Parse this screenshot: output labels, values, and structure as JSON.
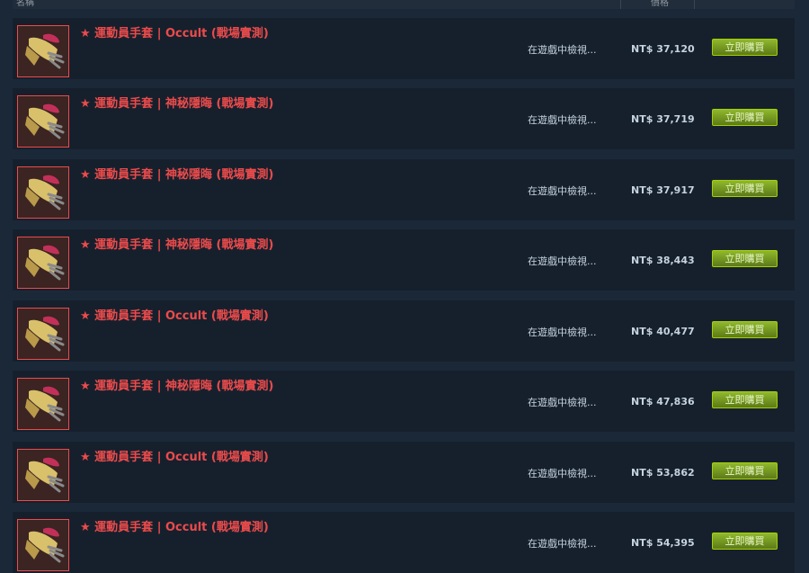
{
  "header": {
    "name_col": "名稱",
    "price_col": "價格"
  },
  "listings": [
    {
      "name": "★ 運動員手套 | Occult (戰場實測)",
      "inspect": "在遊戲中檢視...",
      "price": "NT$ 37,120",
      "buy": "立即購買"
    },
    {
      "name": "★ 運動員手套 | 神秘隱晦 (戰場實測)",
      "inspect": "在遊戲中檢視...",
      "price": "NT$ 37,719",
      "buy": "立即購買"
    },
    {
      "name": "★ 運動員手套 | 神秘隱晦 (戰場實測)",
      "inspect": "在遊戲中檢視...",
      "price": "NT$ 37,917",
      "buy": "立即購買"
    },
    {
      "name": "★ 運動員手套 | 神秘隱晦 (戰場實測)",
      "inspect": "在遊戲中檢視...",
      "price": "NT$ 38,443",
      "buy": "立即購買"
    },
    {
      "name": "★ 運動員手套 | Occult (戰場實測)",
      "inspect": "在遊戲中檢視...",
      "price": "NT$ 40,477",
      "buy": "立即購買"
    },
    {
      "name": "★ 運動員手套 | 神秘隱晦 (戰場實測)",
      "inspect": "在遊戲中檢視...",
      "price": "NT$ 47,836",
      "buy": "立即購買"
    },
    {
      "name": "★ 運動員手套 | Occult (戰場實測)",
      "inspect": "在遊戲中檢視...",
      "price": "NT$ 53,862",
      "buy": "立即購買"
    },
    {
      "name": "★ 運動員手套 | Occult (戰場實測)",
      "inspect": "在遊戲中檢視...",
      "price": "NT$ 54,395",
      "buy": "立即購買"
    }
  ],
  "colors": {
    "rarity": "#eb4b4b",
    "buy_button": "#8fb82c",
    "background": "#1b2838"
  },
  "icons": {
    "thumbnail": "glove-icon"
  }
}
